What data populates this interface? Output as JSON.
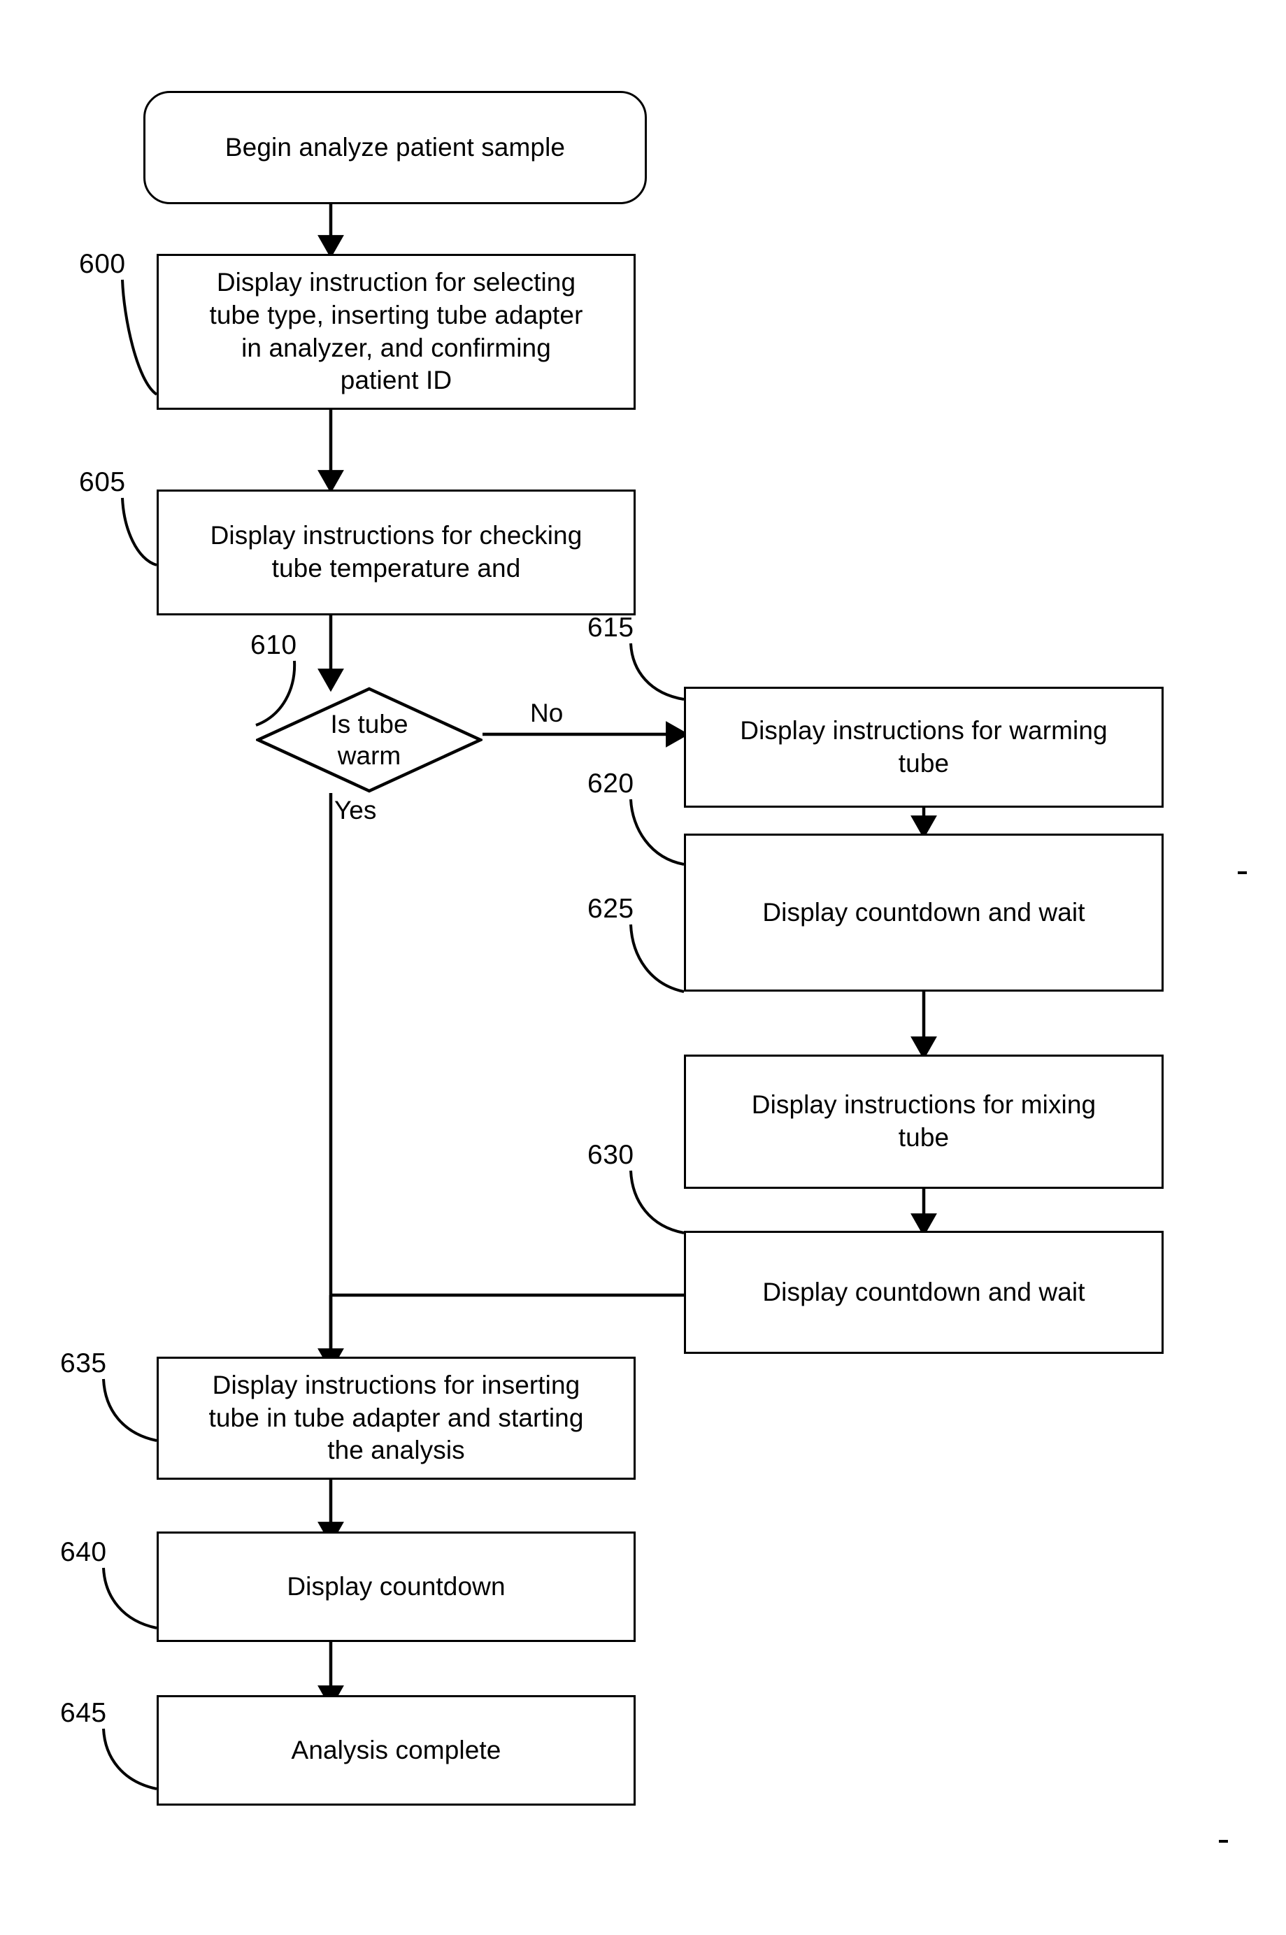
{
  "figure": {
    "type": "patent-flowchart",
    "background_color": "#ffffff",
    "line_color": "#000000"
  },
  "nodes": {
    "start": {
      "ref": "",
      "label": "Begin analyze patient sample",
      "shape": "rounded-rectangle"
    },
    "n600": {
      "ref": "600",
      "label": "Display instruction for selecting\ntube type, inserting tube adapter\nin analyzer, and confirming\npatient ID",
      "shape": "rectangle"
    },
    "n605": {
      "ref": "605",
      "label": "Display instructions for checking\ntube temperature and",
      "shape": "rectangle"
    },
    "n610": {
      "ref": "610",
      "label": "Is tube\nwarm",
      "shape": "diamond"
    },
    "n615": {
      "ref": "615",
      "label": "Display instructions for warming\ntube",
      "shape": "rectangle"
    },
    "n620": {
      "ref": "620",
      "label": "Display countdown and wait",
      "shape": "rectangle"
    },
    "n625": {
      "ref": "625",
      "label": "Display instructions for mixing\ntube",
      "shape": "rectangle"
    },
    "n630": {
      "ref": "630",
      "label": "Display countdown and wait",
      "shape": "rectangle"
    },
    "n635": {
      "ref": "635",
      "label": "Display instructions for inserting\ntube in tube adapter and starting\nthe analysis",
      "shape": "rectangle"
    },
    "n640": {
      "ref": "640",
      "label": "Display countdown",
      "shape": "rectangle"
    },
    "n645": {
      "ref": "645",
      "label": "Analysis complete",
      "shape": "rectangle"
    }
  },
  "edge_labels": {
    "no": "No",
    "yes": "Yes"
  },
  "flow": [
    {
      "from": "start",
      "to": "n600",
      "label": ""
    },
    {
      "from": "n600",
      "to": "n605",
      "label": ""
    },
    {
      "from": "n605",
      "to": "n610",
      "label": ""
    },
    {
      "from": "n610",
      "to": "n615",
      "label": "No"
    },
    {
      "from": "n610",
      "to": "n635",
      "label": "Yes"
    },
    {
      "from": "n615",
      "to": "n620",
      "label": ""
    },
    {
      "from": "n620",
      "to": "n625",
      "label": ""
    },
    {
      "from": "n625",
      "to": "n630",
      "label": ""
    },
    {
      "from": "n630",
      "to": "n635",
      "label": ""
    },
    {
      "from": "n635",
      "to": "n640",
      "label": ""
    },
    {
      "from": "n640",
      "to": "n645",
      "label": ""
    }
  ]
}
